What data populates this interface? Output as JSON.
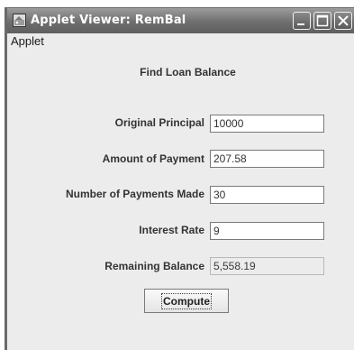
{
  "window": {
    "title": "Applet Viewer: RemBal",
    "icon": "java-applet-icon",
    "controls": [
      "minimize-icon",
      "maximize-icon",
      "close-icon"
    ]
  },
  "menu": {
    "items": [
      {
        "label": "Applet"
      }
    ]
  },
  "form": {
    "heading": "Find Loan Balance",
    "fields": [
      {
        "label": "Original Principal",
        "value": "10000"
      },
      {
        "label": "Amount of Payment",
        "value": "207.58"
      },
      {
        "label": "Number of Payments Made",
        "value": "30"
      },
      {
        "label": "Interest Rate",
        "value": "9"
      },
      {
        "label": "Remaining Balance",
        "value": "5,558.19"
      }
    ],
    "compute_label": "Compute"
  },
  "colors": {
    "title_bar": "#6e6e6e",
    "background": "#ececec",
    "field_border": "#7a7a7a"
  }
}
